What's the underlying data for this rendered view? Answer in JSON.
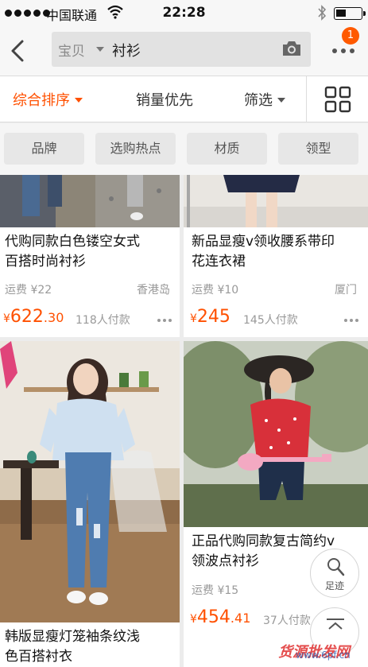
{
  "status_bar": {
    "carrier": "中国联通",
    "time": "22:28"
  },
  "header": {
    "search_scope": "宝贝",
    "search_query": "衬衫",
    "notification_count": "1",
    "icons": {
      "back": "back-arrow-icon",
      "camera": "camera-icon",
      "more": "more-dots-icon"
    }
  },
  "sort_bar": {
    "items": [
      {
        "label": "综合排序",
        "active": true
      },
      {
        "label": "销量优先",
        "active": false
      },
      {
        "label": "筛选",
        "active": false
      }
    ],
    "accent_color": "#ff5000",
    "view_toggle_icon": "grid-view-icon"
  },
  "filters": [
    "品牌",
    "选购热点",
    "材质",
    "领型"
  ],
  "products": [
    {
      "title_line1": "代购同款白色镂空女式",
      "title_line2": "百搭时尚衬衫",
      "shipping": "运费 ¥22",
      "location": "香港岛",
      "price_currency": "¥",
      "price_int": "622",
      "price_dec": ".30",
      "sold": "118人付款"
    },
    {
      "title_line1": "新品显瘦v领收腰系带印",
      "title_line2": "花连衣裙",
      "shipping": "运费 ¥10",
      "location": "厦门",
      "price_currency": "¥",
      "price_int": "245",
      "price_dec": "",
      "sold": "145人付款"
    },
    {
      "title_line1": "韩版显瘦灯笼袖条纹浅",
      "title_line2": "色百搭衬衣"
    },
    {
      "title_line1": "正品代购同款复古简约v",
      "title_line2": "领波点衬衫",
      "shipping": "运费 ¥15",
      "price_currency": "¥",
      "price_int": "454",
      "price_dec": ".41",
      "sold": "37人付款"
    }
  ],
  "floating": {
    "footprint_label": "足迹"
  },
  "watermark": "货源批发网",
  "watermark_url": "www.6pf.cn"
}
